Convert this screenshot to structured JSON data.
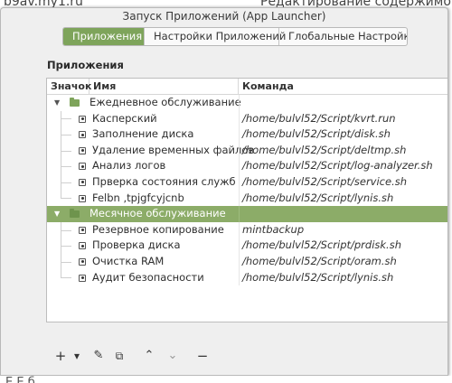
{
  "background": {
    "top_left_text": "b9av.my1.ru",
    "top_right_text": "Редактирование содержимого ст",
    "bottom_text": "Е     Е                б"
  },
  "window": {
    "title": "Запуск Приложений (App Launcher)"
  },
  "tabs": [
    {
      "label": "Приложения",
      "active": true
    },
    {
      "label": "Настройки Приложений",
      "active": false
    },
    {
      "label": "Глобальные Настройки",
      "active": false
    }
  ],
  "section_title": "Приложения",
  "table": {
    "headers": [
      "Значок",
      "Имя",
      "Команда"
    ],
    "groups": [
      {
        "name": "Ежедневное обслуживание",
        "selected": false,
        "items": [
          {
            "name": "Касперский",
            "command": "/home/bulvl52/Script/kvrt.run"
          },
          {
            "name": "Заполнение диска",
            "command": "/home/bulvl52/Script/disk.sh"
          },
          {
            "name": "Удаление временных файлов",
            "command": "/home/bulvl52/Script/deltmp.sh"
          },
          {
            "name": "Анализ логов",
            "command": "/home/bulvl52/Script/log-analyzer.sh"
          },
          {
            "name": "Прверка состояния служб",
            "command": "/home/bulvl52/Script/service.sh"
          },
          {
            "name": "Felbn ,tpjgfcyjcnb",
            "command": "/home/bulvl52/Script/lynis.sh"
          }
        ]
      },
      {
        "name": "Месячное обслуживание",
        "selected": true,
        "items": [
          {
            "name": "Резервное копирование",
            "command": "mintbackup"
          },
          {
            "name": "Проверка диска",
            "command": "/home/bulvl52/Script/prdisk.sh"
          },
          {
            "name": "Очистка RAM",
            "command": "/home/bulvl52/Script/oram.sh"
          },
          {
            "name": "Аудит безопасности",
            "command": "/home/bulvl52/Script/lynis.sh"
          }
        ]
      }
    ]
  },
  "toolbar": {
    "add": "+",
    "add_dropdown": "▾",
    "edit": "✎",
    "copy": "⧉",
    "move_up": "⌃",
    "move_down": "⌄",
    "remove": "−"
  },
  "colors": {
    "accent": "#7ea45b",
    "selected_row": "#8cac68"
  }
}
